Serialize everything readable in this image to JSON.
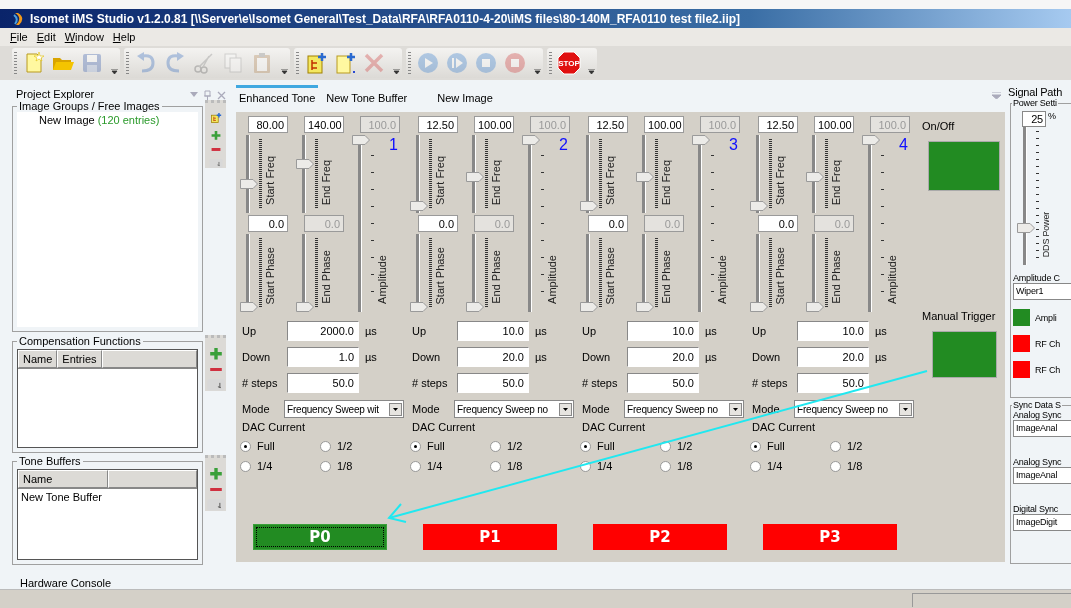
{
  "window": {
    "title": "Isomet iMS Studio v1.2.0.81 [\\\\Server\\e\\Isomet General\\Test_Data\\RFA\\RFA0110-4-20\\iMS files\\80-140M_RFA0110 test file2.iip]"
  },
  "menu": [
    "File",
    "Edit",
    "Window",
    "Help"
  ],
  "toolbar": [
    [
      {
        "kind": "new",
        "disabled": false
      },
      {
        "kind": "open",
        "disabled": false
      },
      {
        "kind": "save",
        "disabled": true
      }
    ],
    [
      {
        "kind": "undo",
        "disabled": true
      },
      {
        "kind": "redo",
        "disabled": true
      },
      {
        "kind": "cut",
        "disabled": true
      },
      {
        "kind": "copy",
        "disabled": true
      },
      {
        "kind": "paste",
        "disabled": true
      }
    ],
    [
      {
        "kind": "add-image",
        "disabled": false
      },
      {
        "kind": "add-item",
        "disabled": false
      },
      {
        "kind": "delete",
        "disabled": true
      }
    ],
    [
      {
        "kind": "play",
        "disabled": true
      },
      {
        "kind": "step",
        "disabled": true
      },
      {
        "kind": "stop",
        "disabled": true
      },
      {
        "kind": "record",
        "disabled": true
      }
    ],
    [
      {
        "kind": "stop-sign",
        "disabled": false,
        "label": "STOP"
      }
    ]
  ],
  "project_explorer": {
    "title": "Project Explorer",
    "image_groups": {
      "title": "Image Groups / Free Images",
      "items": [
        {
          "name": "New Image",
          "count": "(120 entries)"
        }
      ]
    },
    "compensation": {
      "title": "Compensation Functions",
      "columns": [
        "Name",
        "Entries"
      ]
    },
    "tone_buffers": {
      "title": "Tone Buffers",
      "columns": [
        "Name"
      ],
      "rows": [
        "New Tone Buffer"
      ]
    }
  },
  "hardware_console": "Hardware Console",
  "tabs": [
    {
      "label": "Enhanced Tone",
      "selected": true
    },
    {
      "label": "New Tone Buffer",
      "selected": false
    },
    {
      "label": "New Image",
      "selected": false
    }
  ],
  "channels": [
    {
      "number": "1",
      "freq": [
        {
          "label": "Start Freq",
          "value": "80.00",
          "level": 0.36,
          "disabled": false
        },
        {
          "label": "End Freq",
          "value": "140.00",
          "level": 0.65,
          "disabled": false
        }
      ],
      "phase": [
        {
          "label": "Start Phase",
          "value": "0.0",
          "level": 0,
          "disabled": false
        },
        {
          "label": "End Phase",
          "value": "0.0",
          "level": 0,
          "disabled": true
        }
      ],
      "amplitude": {
        "label": "Amplitude",
        "value": "100.0",
        "level": 1,
        "disabled": true
      },
      "fields": [
        {
          "label": "Up",
          "value": "2000.0",
          "unit": "µs"
        },
        {
          "label": "Down",
          "value": "1.0",
          "unit": "µs"
        },
        {
          "label": "# steps",
          "value": "50.0"
        }
      ],
      "mode": {
        "label": "Mode",
        "value": "Frequency Sweep wit"
      },
      "dac": {
        "label": "DAC Current",
        "options": [
          {
            "label": "Full",
            "selected": true
          },
          {
            "label": "1/2",
            "selected": false
          },
          {
            "label": "1/4",
            "selected": false
          },
          {
            "label": "1/8",
            "selected": false
          }
        ]
      },
      "button": {
        "label": "P0",
        "selected": true
      }
    },
    {
      "number": "2",
      "freq": [
        {
          "label": "Start Freq",
          "value": "12.50",
          "level": 0.03,
          "disabled": false
        },
        {
          "label": "End Freq",
          "value": "100.00",
          "level": 0.45,
          "disabled": false
        }
      ],
      "phase": [
        {
          "label": "Start Phase",
          "value": "0.0",
          "level": 0,
          "disabled": false
        },
        {
          "label": "End Phase",
          "value": "0.0",
          "level": 0,
          "disabled": true
        }
      ],
      "amplitude": {
        "label": "Amplitude",
        "value": "100.0",
        "level": 1,
        "disabled": true
      },
      "fields": [
        {
          "label": "Up",
          "value": "10.0",
          "unit": "µs"
        },
        {
          "label": "Down",
          "value": "20.0",
          "unit": "µs"
        },
        {
          "label": "# steps",
          "value": "50.0"
        }
      ],
      "mode": {
        "label": "Mode",
        "value": "Frequency Sweep no"
      },
      "dac": {
        "label": "DAC Current",
        "options": [
          {
            "label": "Full",
            "selected": true
          },
          {
            "label": "1/2",
            "selected": false
          },
          {
            "label": "1/4",
            "selected": false
          },
          {
            "label": "1/8",
            "selected": false
          }
        ]
      },
      "button": {
        "label": "P1",
        "selected": false
      }
    },
    {
      "number": "3",
      "freq": [
        {
          "label": "Start Freq",
          "value": "12.50",
          "level": 0.03,
          "disabled": false
        },
        {
          "label": "End Freq",
          "value": "100.00",
          "level": 0.45,
          "disabled": false
        }
      ],
      "phase": [
        {
          "label": "Start Phase",
          "value": "0.0",
          "level": 0,
          "disabled": false
        },
        {
          "label": "End Phase",
          "value": "0.0",
          "level": 0,
          "disabled": true
        }
      ],
      "amplitude": {
        "label": "Amplitude",
        "value": "100.0",
        "level": 1,
        "disabled": true
      },
      "fields": [
        {
          "label": "Up",
          "value": "10.0",
          "unit": "µs"
        },
        {
          "label": "Down",
          "value": "20.0",
          "unit": "µs"
        },
        {
          "label": "# steps",
          "value": "50.0"
        }
      ],
      "mode": {
        "label": "Mode",
        "value": "Frequency Sweep no"
      },
      "dac": {
        "label": "DAC Current",
        "options": [
          {
            "label": "Full",
            "selected": true
          },
          {
            "label": "1/2",
            "selected": false
          },
          {
            "label": "1/4",
            "selected": false
          },
          {
            "label": "1/8",
            "selected": false
          }
        ]
      },
      "button": {
        "label": "P2",
        "selected": false
      }
    },
    {
      "number": "4",
      "freq": [
        {
          "label": "Start Freq",
          "value": "12.50",
          "level": 0.03,
          "disabled": false
        },
        {
          "label": "End Freq",
          "value": "100.00",
          "level": 0.45,
          "disabled": false
        }
      ],
      "phase": [
        {
          "label": "Start Phase",
          "value": "0.0",
          "level": 0,
          "disabled": false
        },
        {
          "label": "End Phase",
          "value": "0.0",
          "level": 0,
          "disabled": true
        }
      ],
      "amplitude": {
        "label": "Amplitude",
        "value": "100.0",
        "level": 1,
        "disabled": true
      },
      "fields": [
        {
          "label": "Up",
          "value": "10.0",
          "unit": "µs"
        },
        {
          "label": "Down",
          "value": "20.0",
          "unit": "µs"
        },
        {
          "label": "# steps",
          "value": "50.0"
        }
      ],
      "mode": {
        "label": "Mode",
        "value": "Frequency Sweep no"
      },
      "dac": {
        "label": "DAC Current",
        "options": [
          {
            "label": "Full",
            "selected": true
          },
          {
            "label": "1/2",
            "selected": false
          },
          {
            "label": "1/4",
            "selected": false
          },
          {
            "label": "1/8",
            "selected": false
          }
        ]
      },
      "button": {
        "label": "P3",
        "selected": false
      }
    }
  ],
  "on_off": {
    "label": "On/Off",
    "on": true
  },
  "manual_trigger": {
    "label": "Manual Trigger",
    "on": true
  },
  "signal_path": {
    "title": "Signal Path",
    "power": {
      "title": "Power Setti",
      "value": "25",
      "unit": "%",
      "slider_label": "DDS Power",
      "level": 0.25
    },
    "amplitude_control": {
      "label": "Amplitude C",
      "value": "Wiper1"
    },
    "indicators": [
      {
        "label": "Ampli",
        "color": "#228b22"
      },
      {
        "label": "RF Ch",
        "color": "#ff0000"
      },
      {
        "label": "RF Ch",
        "color": "#ff0000"
      }
    ],
    "sync": {
      "title": "Sync Data S",
      "fields": [
        {
          "label": "Analog Sync",
          "value": "ImageAnal"
        },
        {
          "label": "Analog Sync",
          "value": "ImageAnal"
        },
        {
          "label": "Digital Sync",
          "value": "ImageDigit"
        }
      ]
    }
  }
}
